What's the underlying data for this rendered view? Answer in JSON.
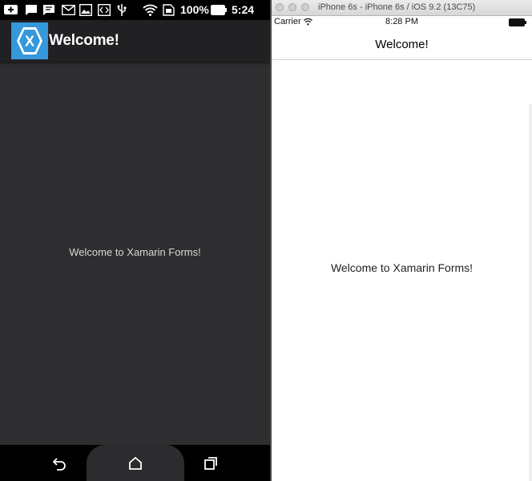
{
  "android": {
    "status_bar": {
      "icons": [
        "add-notification-icon",
        "chat-icon",
        "message-icon",
        "gmail-icon",
        "image-icon",
        "code-icon",
        "usb-icon",
        "wifi-icon",
        "sim-icon"
      ],
      "battery_text": "100%",
      "time": "5:24"
    },
    "action_bar": {
      "logo_letter": "X",
      "title": "Welcome!"
    },
    "content": {
      "welcome_text": "Welcome to Xamarin Forms!"
    },
    "nav_bar": {
      "buttons": [
        "back-icon",
        "home-icon",
        "recents-icon"
      ]
    },
    "colors": {
      "background": "#2e2d2f",
      "action_bar": "#212022",
      "logo": "#3498db"
    }
  },
  "ios": {
    "window_title": "iPhone 6s - iPhone 6s / iOS 9.2 (13C75)",
    "status_bar": {
      "carrier": "Carrier",
      "time": "8:28 PM"
    },
    "nav_bar": {
      "title": "Welcome!"
    },
    "content": {
      "welcome_text": "Welcome to Xamarin Forms!"
    }
  }
}
